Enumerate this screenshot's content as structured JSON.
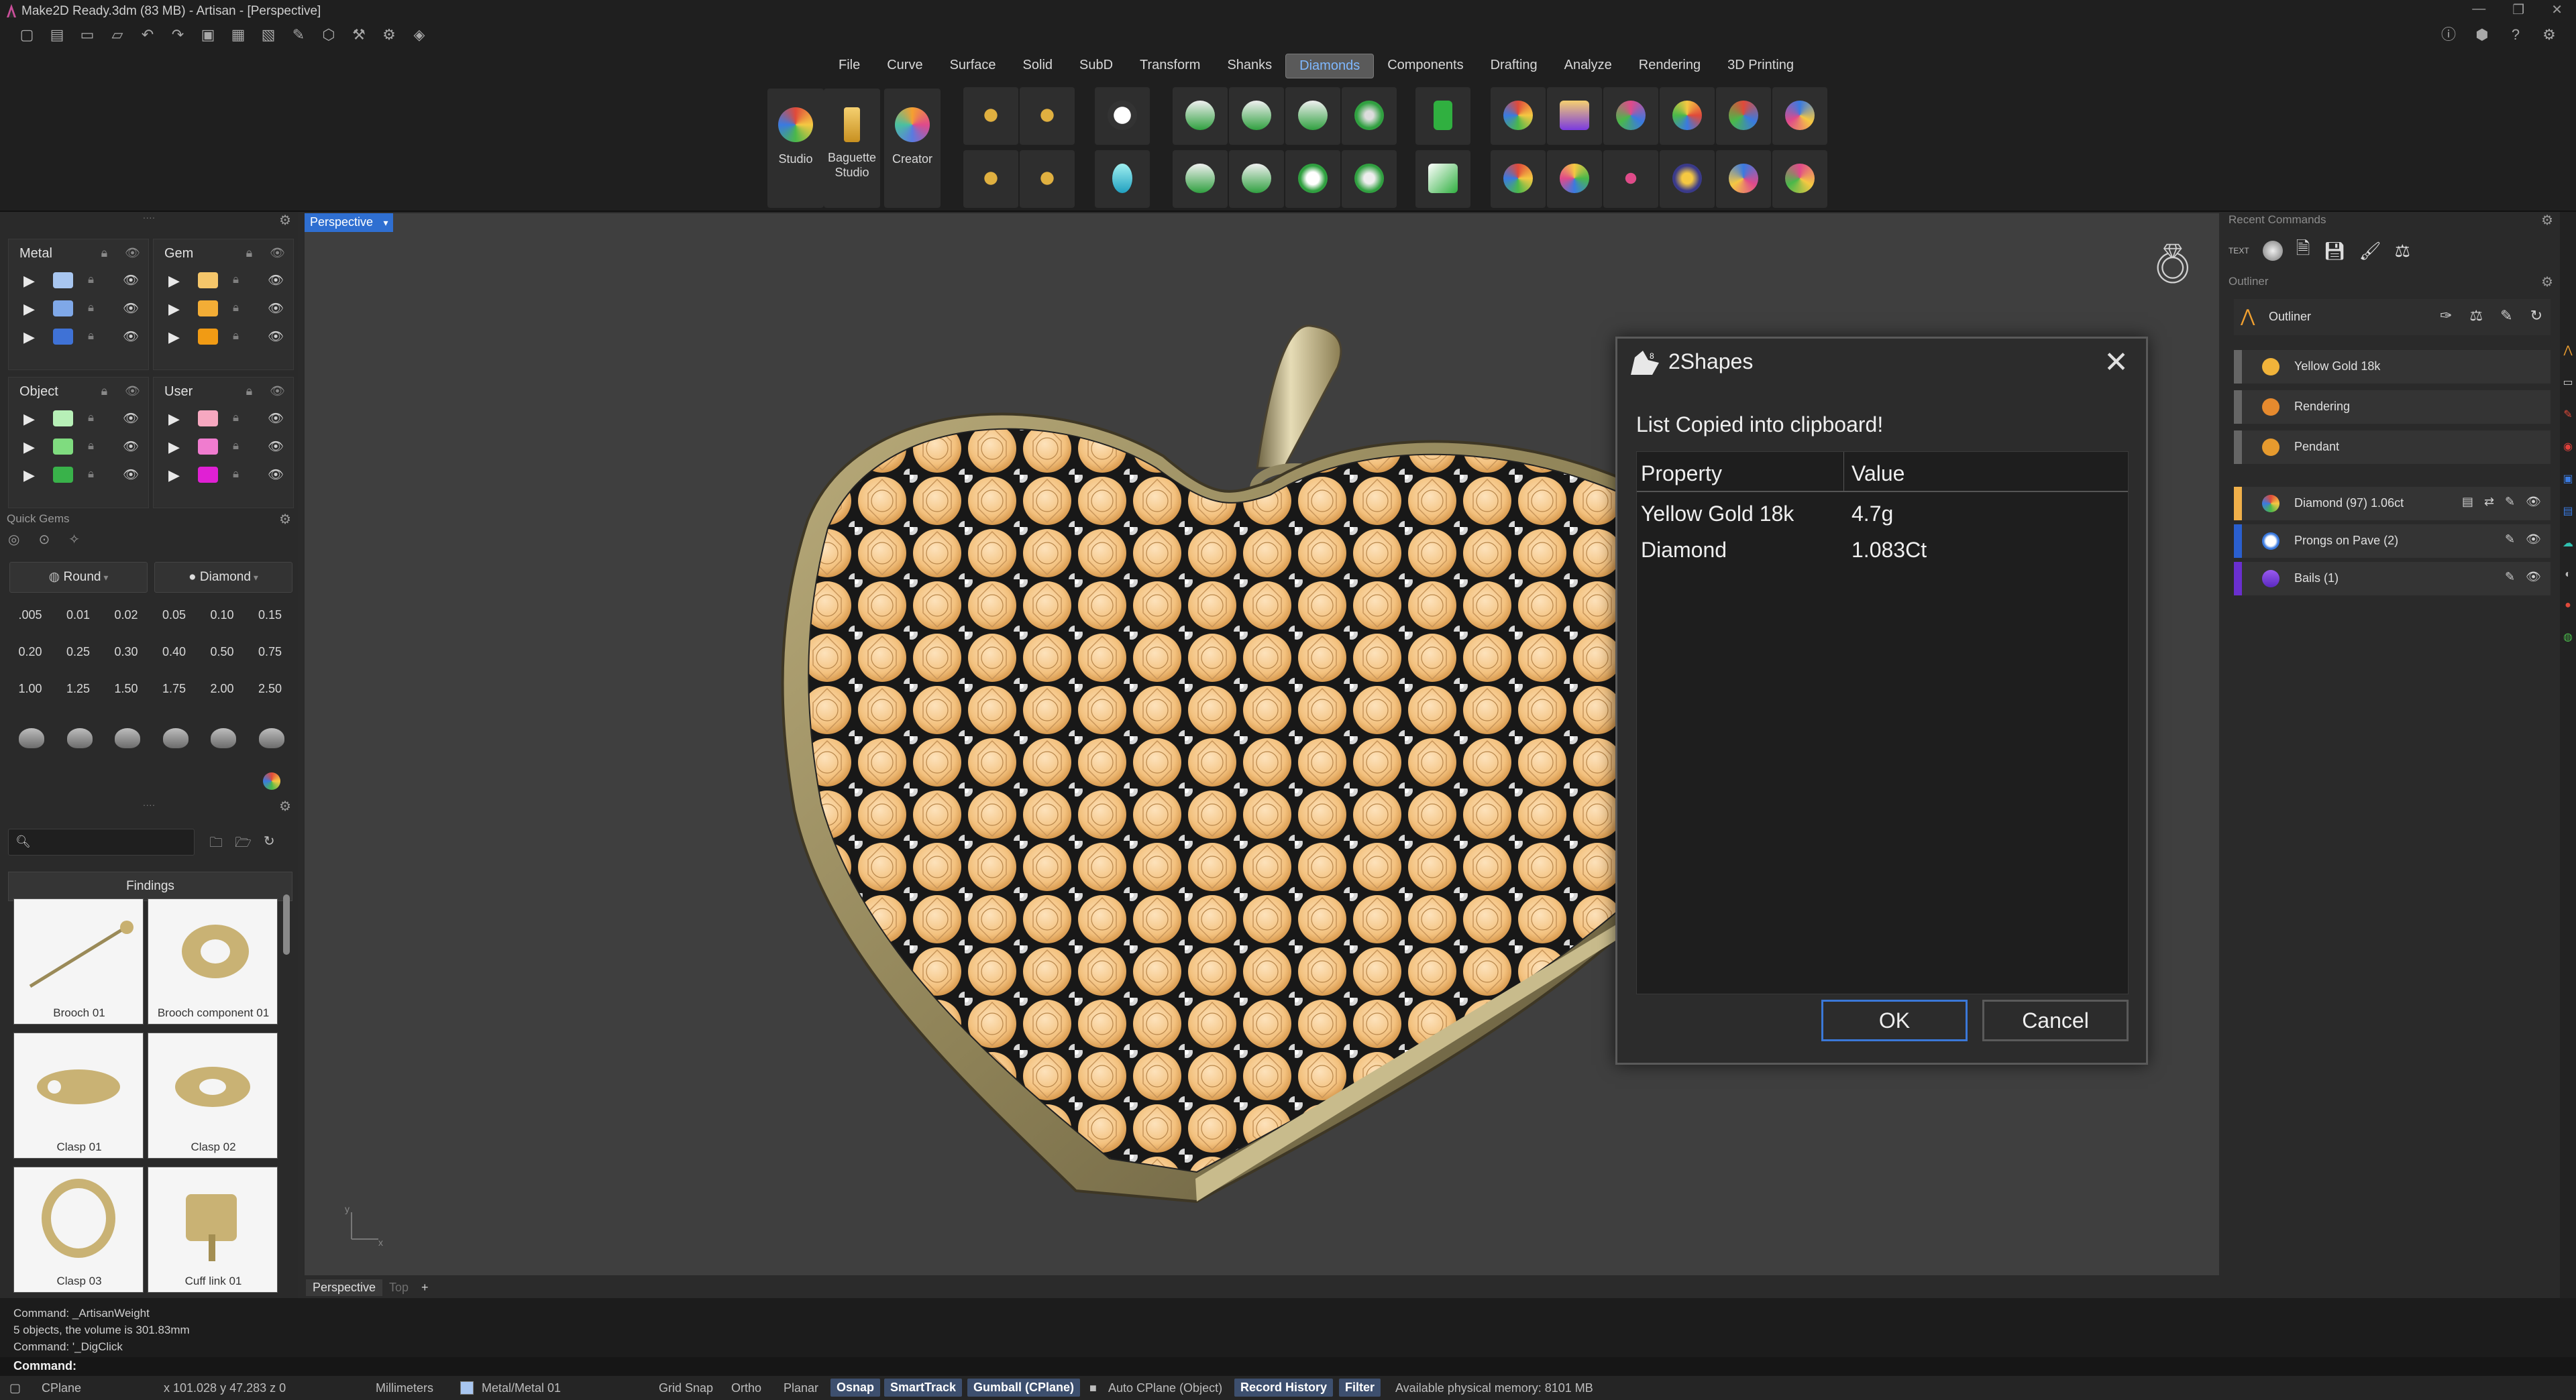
{
  "window": {
    "title": "Make2D Ready.3dm (83 MB) - Artisan - [Perspective]"
  },
  "menu": {
    "tabs": [
      "File",
      "Curve",
      "Surface",
      "Solid",
      "SubD",
      "Transform",
      "Shanks",
      "Diamonds",
      "Components",
      "Drafting",
      "Analyze",
      "Rendering",
      "3D Printing"
    ],
    "active": "Diamonds"
  },
  "ribbon": {
    "big_buttons": [
      {
        "label": "Studio",
        "color": "#d9a64a"
      },
      {
        "label": "Baguette Studio",
        "color": "#e0b640"
      },
      {
        "label": "Creator",
        "color": "#e07a3a"
      }
    ]
  },
  "left_panel": {
    "layer_groups": [
      {
        "name": "Metal",
        "swatches": [
          "#a8c6f0",
          "#7fa8e8",
          "#3f72d6"
        ]
      },
      {
        "name": "Gem",
        "swatches": [
          "#f5c66a",
          "#f3ad36",
          "#f19b14"
        ]
      },
      {
        "name": "Object",
        "swatches": [
          "#b7f0b7",
          "#7fdc7f",
          "#39b24a"
        ]
      },
      {
        "name": "User",
        "swatches": [
          "#f6a8c0",
          "#f07ccf",
          "#e020d4"
        ]
      }
    ],
    "quick_gems_label": "Quick Gems",
    "shape_dropdown": "Round",
    "material_dropdown": "Diamond",
    "sizes": [
      ".005",
      "0.01",
      "0.02",
      "0.05",
      "0.10",
      "0.15",
      "0.20",
      "0.25",
      "0.30",
      "0.40",
      "0.50",
      "0.75",
      "1.00",
      "1.25",
      "1.50",
      "1.75",
      "2.00",
      "2.50"
    ],
    "findings_label": "Findings",
    "findings": [
      "Brooch 01",
      "Brooch component 01",
      "Clasp 01",
      "Clasp 02",
      "Clasp 03",
      "Cuff link 01"
    ]
  },
  "viewport": {
    "label": "Perspective",
    "tabs": [
      "Perspective",
      "Top",
      "+"
    ]
  },
  "right_panel": {
    "recent_label": "Recent Commands",
    "recent_text": "TEXT",
    "outliner_label": "Outliner",
    "outliner_title": "Outliner",
    "items_top": [
      {
        "label": "Yellow Gold 18k",
        "color": "#f1b33a"
      },
      {
        "label": "Rendering",
        "color": "#e68a2e"
      },
      {
        "label": "Pendant",
        "color": "#e69a2e"
      }
    ],
    "items_bottom": [
      {
        "label": "Diamond (97) 1.06ct",
        "bar": "#f0b04a"
      },
      {
        "label": "Prongs on Pave (2)",
        "bar": "#2a5fcf"
      },
      {
        "label": "Bails (1)",
        "bar": "#6a2fcf"
      }
    ]
  },
  "dialog": {
    "title": "2Shapes",
    "message": "List Copied into clipboard!",
    "headers": [
      "Property",
      "Value"
    ],
    "rows": [
      {
        "property": "Yellow Gold 18k",
        "value": "4.7g"
      },
      {
        "property": "Diamond",
        "value": "1.083Ct"
      }
    ],
    "ok": "OK",
    "cancel": "Cancel"
  },
  "command": {
    "history": [
      "Command: _ArtisanWeight",
      "5 objects, the volume is 301.83mm",
      "Command: '_DigClick"
    ],
    "prompt": "Command:"
  },
  "status": {
    "cplane": "CPlane",
    "coords": "x 101.028  y 47.283  z 0",
    "units": "Millimeters",
    "layer": "Metal/Metal 01",
    "grid_snap": "Grid Snap",
    "ortho": "Ortho",
    "planar": "Planar",
    "osnap": "Osnap",
    "smarttrack": "SmartTrack",
    "gumball": "Gumball (CPlane)",
    "auto_cplane": "Auto CPlane (Object)",
    "record_history": "Record History",
    "filter": "Filter",
    "memory": "Available physical memory: 8101 MB"
  }
}
